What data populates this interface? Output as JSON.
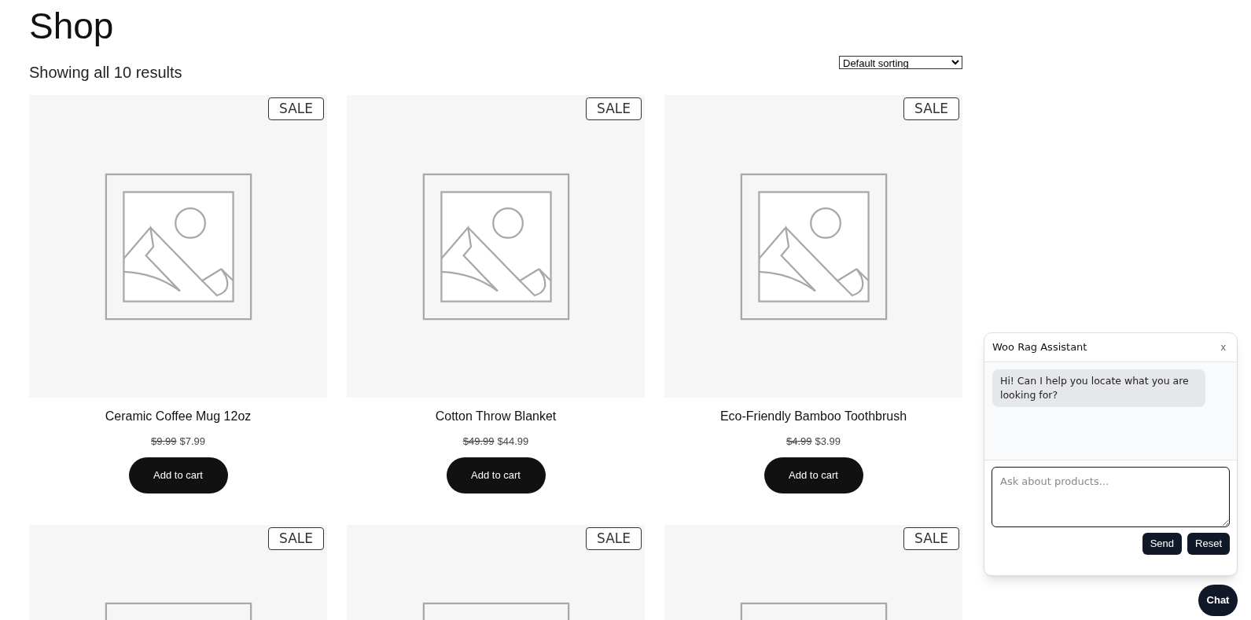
{
  "page_title": "Shop",
  "result_count": "Showing all 10 results",
  "sorting": {
    "value": "Default sorting"
  },
  "products": [
    {
      "badge": "SALE",
      "name": "Ceramic Coffee Mug 12oz",
      "old_price": "$9.99",
      "price": "$7.99",
      "button": "Add to cart"
    },
    {
      "badge": "SALE",
      "name": "Cotton Throw Blanket",
      "old_price": "$49.99",
      "price": "$44.99",
      "button": "Add to cart"
    },
    {
      "badge": "SALE",
      "name": "Eco-Friendly Bamboo Toothbrush",
      "old_price": "$4.99",
      "price": "$3.99",
      "button": "Add to cart"
    },
    {
      "badge": "SALE"
    },
    {
      "badge": "SALE"
    },
    {
      "badge": "SALE"
    }
  ],
  "chat_panel": {
    "title": "Woo Rag Assistant",
    "close": "x",
    "messages": [
      {
        "text": "Hi! Can I help you locate what you are looking for?"
      }
    ],
    "input": {
      "placeholder": "Ask about products..."
    },
    "buttons": [
      "Send",
      "Reset"
    ]
  },
  "chat_button": "Chat"
}
